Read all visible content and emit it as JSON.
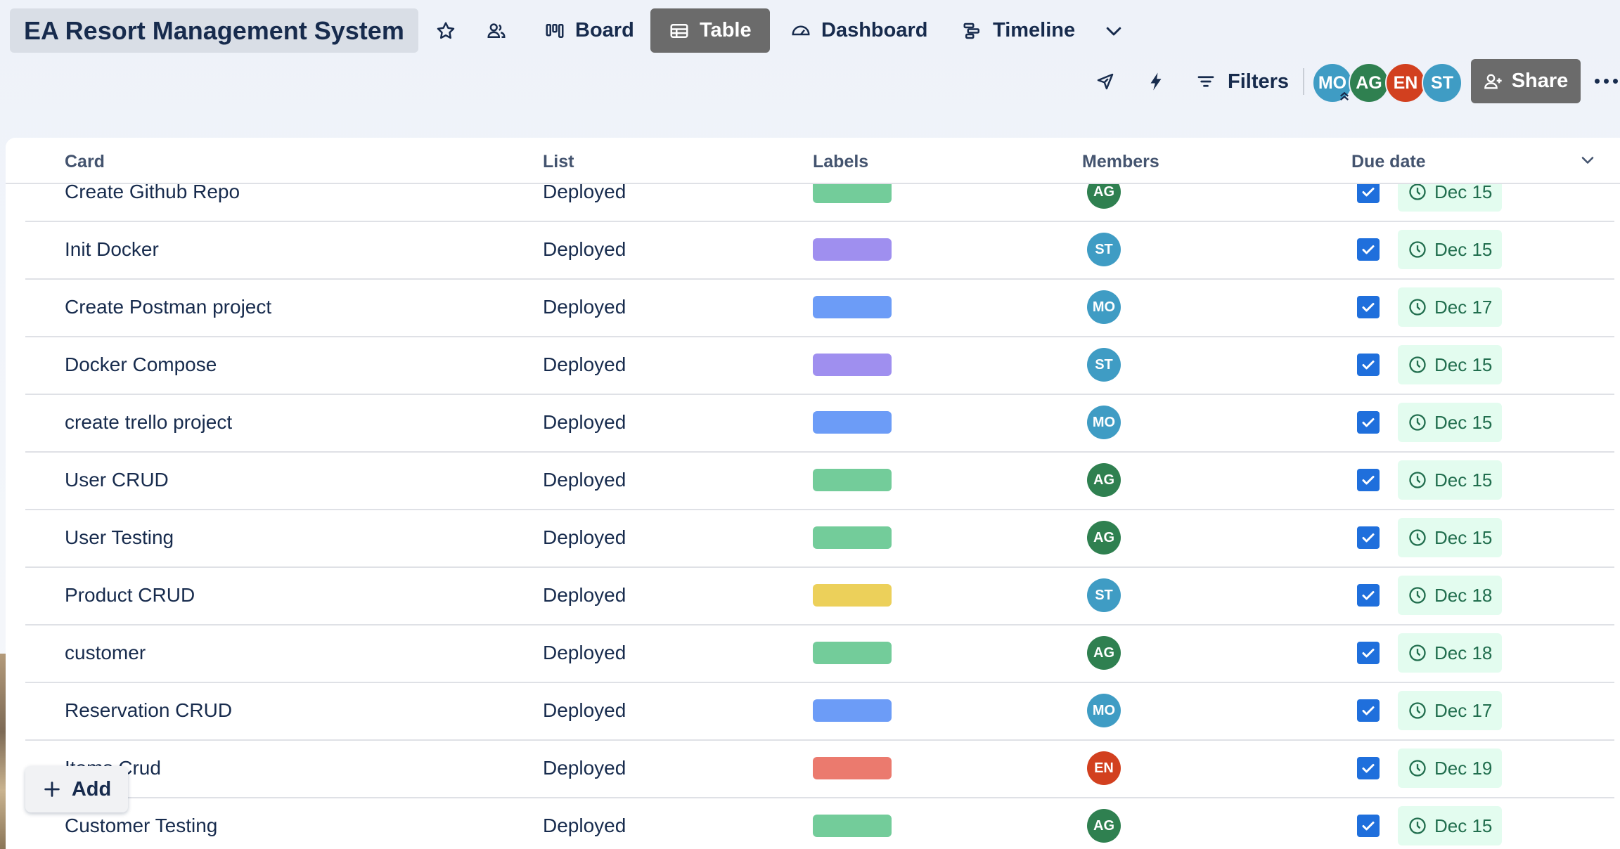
{
  "board": {
    "title": "EA Resort Management System"
  },
  "views": [
    {
      "label": "Board",
      "icon": "board-icon"
    },
    {
      "label": "Table",
      "icon": "table-icon",
      "active": true
    },
    {
      "label": "Dashboard",
      "icon": "dashboard-icon"
    },
    {
      "label": "Timeline",
      "icon": "timeline-icon"
    }
  ],
  "toolbar": {
    "filters_label": "Filters",
    "share_label": "Share"
  },
  "board_members": [
    {
      "initials": "MO",
      "color": "#3f9cc4"
    },
    {
      "initials": "AG",
      "color": "#2f8050"
    },
    {
      "initials": "EN",
      "color": "#d2401f"
    },
    {
      "initials": "ST",
      "color": "#3f9cc4"
    }
  ],
  "table": {
    "columns": [
      "Card",
      "List",
      "Labels",
      "Members",
      "Due date"
    ],
    "rows": [
      {
        "card": "Create Github Repo",
        "list": "Deployed",
        "label_color": "#73cc9a",
        "member": "AG",
        "member_color": "#2f8050",
        "due": "Dec 15"
      },
      {
        "card": "Init Docker",
        "list": "Deployed",
        "label_color": "#9f8fef",
        "member": "ST",
        "member_color": "#3f9cc4",
        "due": "Dec 15"
      },
      {
        "card": "Create Postman project",
        "list": "Deployed",
        "label_color": "#6c9cf7",
        "member": "MO",
        "member_color": "#3f9cc4",
        "due": "Dec 17"
      },
      {
        "card": "Docker Compose",
        "list": "Deployed",
        "label_color": "#9f8fef",
        "member": "ST",
        "member_color": "#3f9cc4",
        "due": "Dec 15"
      },
      {
        "card": "create trello project",
        "list": "Deployed",
        "label_color": "#6c9cf7",
        "member": "MO",
        "member_color": "#3f9cc4",
        "due": "Dec 15"
      },
      {
        "card": "User CRUD",
        "list": "Deployed",
        "label_color": "#73cc9a",
        "member": "AG",
        "member_color": "#2f8050",
        "due": "Dec 15"
      },
      {
        "card": "User Testing",
        "list": "Deployed",
        "label_color": "#73cc9a",
        "member": "AG",
        "member_color": "#2f8050",
        "due": "Dec 15"
      },
      {
        "card": "Product CRUD",
        "list": "Deployed",
        "label_color": "#ecd05a",
        "member": "ST",
        "member_color": "#3f9cc4",
        "due": "Dec 18"
      },
      {
        "card": "customer",
        "list": "Deployed",
        "label_color": "#73cc9a",
        "member": "AG",
        "member_color": "#2f8050",
        "due": "Dec 18"
      },
      {
        "card": "Reservation CRUD",
        "list": "Deployed",
        "label_color": "#6c9cf7",
        "member": "MO",
        "member_color": "#3f9cc4",
        "due": "Dec 17"
      },
      {
        "card": "Items Crud",
        "list": "Deployed",
        "label_color": "#eb7a6e",
        "member": "EN",
        "member_color": "#d2401f",
        "due": "Dec 19"
      },
      {
        "card": "Customer Testing",
        "list": "Deployed",
        "label_color": "#73cc9a",
        "member": "AG",
        "member_color": "#2f8050",
        "due": "Dec 15"
      }
    ]
  },
  "add_button": {
    "label": "Add"
  }
}
